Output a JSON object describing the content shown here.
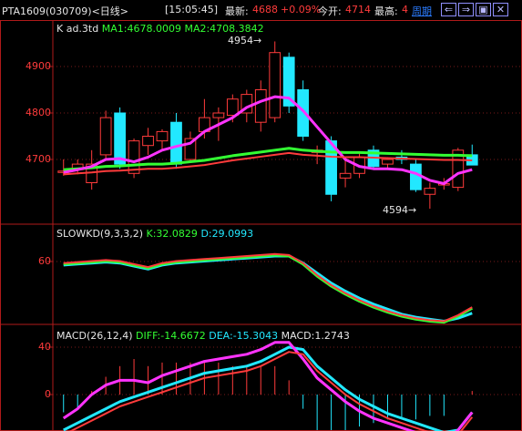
{
  "topbar": {
    "symbol": "PTA1609(030709)<日线>",
    "time": "[15:05:45]",
    "last_label": "最新:",
    "last_value": "4688",
    "change_pct": "+0.09%",
    "open_label": "今开:",
    "open_value": "4714",
    "high_label": "最高:",
    "high_value": "4",
    "period_label": "周期"
  },
  "kline": {
    "title": "K  ad.3td",
    "ma1_label": "MA1:4678.0009",
    "ma2_label": "MA2:4708.3842",
    "y_ticks": [
      "4900",
      "4800",
      "4700"
    ],
    "high_annotation": "4954",
    "low_annotation": "4594"
  },
  "kd": {
    "title": "SLOWKD(9,3,3,2)",
    "k_label": "K:32.0829",
    "d_label": "D:29.0993",
    "y_ticks": [
      "60"
    ]
  },
  "macd": {
    "title": "MACD(26,12,4)",
    "diff_label": "DIFF:-14.6672",
    "dea_label": "DEA:-15.3043",
    "macd_label": "MACD:1.2743",
    "y_ticks": [
      "40",
      "0"
    ]
  },
  "colors": {
    "up": "#ff3b3b",
    "down": "#22e8ff",
    "ma1": "#ff33ff",
    "ma2": "#33ff33",
    "grid": "#7a1a1a",
    "axis": "#b01a1a"
  },
  "chart_data": {
    "type": "candlestick",
    "candles": [
      {
        "o": 4672,
        "h": 4700,
        "l": 4665,
        "c": 4675
      },
      {
        "o": 4678,
        "h": 4700,
        "l": 4668,
        "c": 4690
      },
      {
        "o": 4650,
        "h": 4720,
        "l": 4635,
        "c": 4690
      },
      {
        "o": 4710,
        "h": 4805,
        "l": 4702,
        "c": 4790
      },
      {
        "o": 4800,
        "h": 4812,
        "l": 4680,
        "c": 4690
      },
      {
        "o": 4670,
        "h": 4745,
        "l": 4660,
        "c": 4740
      },
      {
        "o": 4730,
        "h": 4768,
        "l": 4710,
        "c": 4750
      },
      {
        "o": 4740,
        "h": 4765,
        "l": 4720,
        "c": 4760
      },
      {
        "o": 4780,
        "h": 4800,
        "l": 4680,
        "c": 4690
      },
      {
        "o": 4700,
        "h": 4760,
        "l": 4695,
        "c": 4745
      },
      {
        "o": 4760,
        "h": 4830,
        "l": 4745,
        "c": 4790
      },
      {
        "o": 4790,
        "h": 4812,
        "l": 4740,
        "c": 4800
      },
      {
        "o": 4795,
        "h": 4840,
        "l": 4780,
        "c": 4830
      },
      {
        "o": 4800,
        "h": 4850,
        "l": 4780,
        "c": 4840
      },
      {
        "o": 4780,
        "h": 4870,
        "l": 4760,
        "c": 4850
      },
      {
        "o": 4790,
        "h": 4954,
        "l": 4780,
        "c": 4930
      },
      {
        "o": 4920,
        "h": 4930,
        "l": 4800,
        "c": 4815
      },
      {
        "o": 4850,
        "h": 4870,
        "l": 4740,
        "c": 4750
      },
      {
        "o": 4715,
        "h": 4730,
        "l": 4690,
        "c": 4720
      },
      {
        "o": 4740,
        "h": 4750,
        "l": 4610,
        "c": 4625
      },
      {
        "o": 4660,
        "h": 4700,
        "l": 4640,
        "c": 4670
      },
      {
        "o": 4670,
        "h": 4715,
        "l": 4660,
        "c": 4705
      },
      {
        "o": 4720,
        "h": 4730,
        "l": 4680,
        "c": 4685
      },
      {
        "o": 4690,
        "h": 4705,
        "l": 4680,
        "c": 4700
      },
      {
        "o": 4705,
        "h": 4720,
        "l": 4690,
        "c": 4700
      },
      {
        "o": 4690,
        "h": 4700,
        "l": 4630,
        "c": 4635
      },
      {
        "o": 4625,
        "h": 4650,
        "l": 4594,
        "c": 4638
      },
      {
        "o": 4645,
        "h": 4660,
        "l": 4635,
        "c": 4648
      },
      {
        "o": 4640,
        "h": 4725,
        "l": 4632,
        "c": 4720
      },
      {
        "o": 4710,
        "h": 4732,
        "l": 4690,
        "c": 4688
      }
    ],
    "ma1": [
      4672,
      4678,
      4685,
      4700,
      4702,
      4695,
      4705,
      4720,
      4728,
      4735,
      4760,
      4775,
      4790,
      4812,
      4825,
      4835,
      4832,
      4805,
      4770,
      4735,
      4700,
      4685,
      4680,
      4680,
      4678,
      4670,
      4655,
      4648,
      4670,
      4678
    ],
    "ma2": [
      4678,
      4680,
      4682,
      4685,
      4686,
      4688,
      4690,
      4690,
      4692,
      4695,
      4698,
      4703,
      4708,
      4712,
      4716,
      4720,
      4724,
      4720,
      4718,
      4716,
      4715,
      4715,
      4714,
      4713,
      4712,
      4711,
      4710,
      4709,
      4709,
      4708
    ],
    "kd_k": [
      62,
      63,
      64,
      65,
      64,
      61,
      58,
      62,
      64,
      65,
      66,
      67,
      68,
      69,
      70,
      71,
      70,
      62,
      50,
      40,
      32,
      25,
      19,
      14,
      10,
      7,
      5,
      4,
      10,
      18
    ],
    "kd_d": [
      61,
      62,
      63,
      64,
      63,
      60,
      57,
      61,
      63,
      64,
      65,
      66,
      67,
      68,
      69,
      70,
      70,
      63,
      53,
      43,
      35,
      28,
      22,
      17,
      12,
      9,
      7,
      5,
      8,
      13
    ],
    "macd_diff": [
      -20,
      -12,
      0,
      8,
      12,
      12,
      10,
      16,
      20,
      24,
      28,
      30,
      32,
      34,
      38,
      44,
      44,
      30,
      14,
      4,
      -6,
      -14,
      -20,
      -24,
      -28,
      -32,
      -35,
      -40,
      -30,
      -15
    ],
    "macd_dea": [
      -30,
      -24,
      -18,
      -12,
      -6,
      -2,
      2,
      6,
      10,
      14,
      18,
      20,
      22,
      24,
      28,
      34,
      40,
      38,
      24,
      14,
      4,
      -4,
      -10,
      -16,
      -20,
      -24,
      -28,
      -32,
      -30,
      -15
    ],
    "macd_hist": [
      -5,
      -4,
      1,
      5,
      8,
      10,
      8,
      9,
      9,
      9,
      9,
      9,
      8,
      8,
      8,
      8,
      4,
      -4,
      -10,
      -10,
      -10,
      -9,
      -8,
      -7,
      -7,
      -7,
      -6,
      -6,
      0,
      1
    ]
  }
}
